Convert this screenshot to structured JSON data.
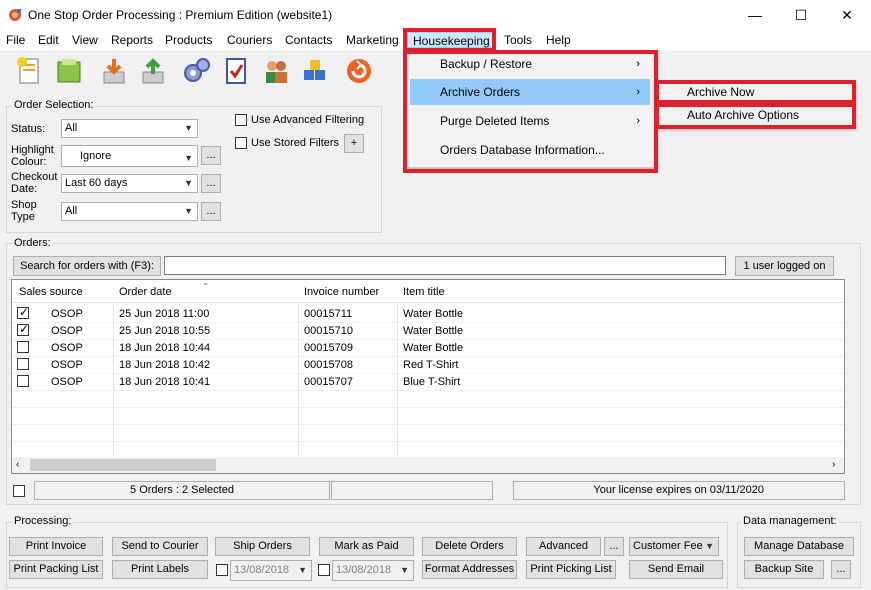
{
  "window": {
    "title": "One Stop Order Processing : Premium Edition (website1)",
    "minimize": "—",
    "maximize": "☐",
    "close": "✕"
  },
  "menu": {
    "file": "File",
    "edit": "Edit",
    "view": "View",
    "reports": "Reports",
    "products": "Products",
    "couriers": "Couriers",
    "contacts": "Contacts",
    "marketing": "Marketing",
    "housekeeping": "Housekeeping",
    "tools": "Tools",
    "help": "Help"
  },
  "housekeeping_menu": {
    "items": [
      "Backup / Restore",
      "Archive Orders",
      "Purge Deleted Items",
      "Orders Database Information..."
    ],
    "submenu_arrow": "›"
  },
  "archive_submenu": {
    "items": [
      "Archive Now",
      "Auto Archive Options"
    ]
  },
  "order_selection": {
    "title": "Order Selection:",
    "status_label": "Status:",
    "status_value": "All",
    "highlight_label": "Highlight Colour:",
    "highlight_value": "Ignore",
    "checkout_label": "Checkout Date:",
    "checkout_value": "Last 60 days",
    "shop_label": "Shop Type",
    "shop_value": "All",
    "advanced_filter": "Use Advanced Filtering",
    "stored_filters": "Use Stored Filters",
    "ellipsis": "...",
    "plus": "+"
  },
  "orders": {
    "title": "Orders:",
    "search_button": "Search for orders with (F3):",
    "search_value": "",
    "users_button": "1 user logged on",
    "columns": [
      "Sales source",
      "Order date",
      "Invoice number",
      "Item title"
    ],
    "rows": [
      {
        "checked": true,
        "source": "OSOP",
        "date": "25 Jun 2018 11:00",
        "invoice": "00015711",
        "item": "Water Bottle"
      },
      {
        "checked": true,
        "source": "OSOP",
        "date": "25 Jun 2018 10:55",
        "invoice": "00015710",
        "item": "Water Bottle"
      },
      {
        "checked": false,
        "source": "OSOP",
        "date": "18 Jun 2018 10:44",
        "invoice": "00015709",
        "item": "Water Bottle"
      },
      {
        "checked": false,
        "source": "OSOP",
        "date": "18 Jun 2018 10:42",
        "invoice": "00015708",
        "item": "Red T-Shirt"
      },
      {
        "checked": false,
        "source": "OSOP",
        "date": "18 Jun 2018 10:41",
        "invoice": "00015707",
        "item": "Blue T-Shirt"
      }
    ],
    "status_count": "5 Orders : 2 Selected",
    "license": "Your license expires on 03/11/2020"
  },
  "processing": {
    "title": "Processing:",
    "print_invoice": "Print Invoice",
    "print_packing": "Print Packing List",
    "send_courier": "Send to Courier",
    "print_labels": "Print Labels",
    "ship_orders": "Ship Orders",
    "date1": "13/08/2018",
    "mark_paid": "Mark as Paid",
    "date2": "13/08/2018",
    "delete_orders": "Delete Orders",
    "format_addresses": "Format Addresses",
    "advanced": "Advanced",
    "print_picking": "Print Picking List",
    "customer_feedback": "Customer Fee",
    "send_email": "Send Email",
    "ellipsis": "..."
  },
  "data_management": {
    "title": "Data management:",
    "manage_db": "Manage Database",
    "backup_site": "Backup Site",
    "ellipsis": "..."
  },
  "colors": {
    "highlight": "#91c9f7",
    "annotation_red": "#e0202c",
    "menu_active": "#cce8ff"
  }
}
